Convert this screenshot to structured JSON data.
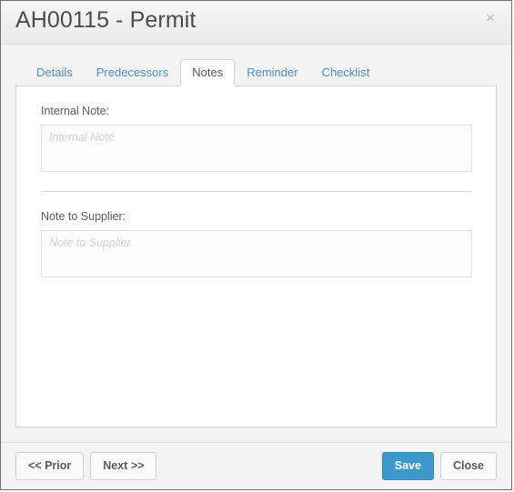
{
  "window": {
    "title": "AH00115 - Permit",
    "close_icon": "close-icon",
    "close_glyph": "×"
  },
  "tabs": [
    {
      "label": "Details",
      "active": false
    },
    {
      "label": "Predecessors",
      "active": false
    },
    {
      "label": "Notes",
      "active": true
    },
    {
      "label": "Reminder",
      "active": false
    },
    {
      "label": "Checklist",
      "active": false
    }
  ],
  "notes_panel": {
    "internal_note": {
      "label": "Internal Note:",
      "value": "",
      "placeholder": "Internal Note"
    },
    "note_to_supplier": {
      "label": "Note to Supplier:",
      "value": "",
      "placeholder": "Note to Supplier"
    }
  },
  "footer": {
    "prior_label": "<< Prior",
    "next_label": "Next >>",
    "save_label": "Save",
    "close_label": "Close"
  },
  "colors": {
    "link_blue": "#4a90c4",
    "primary_button": "#3d99cc",
    "title_text": "#4c4c4c",
    "panel_border": "#d3d3d3",
    "window_border": "#6f6f6f"
  }
}
